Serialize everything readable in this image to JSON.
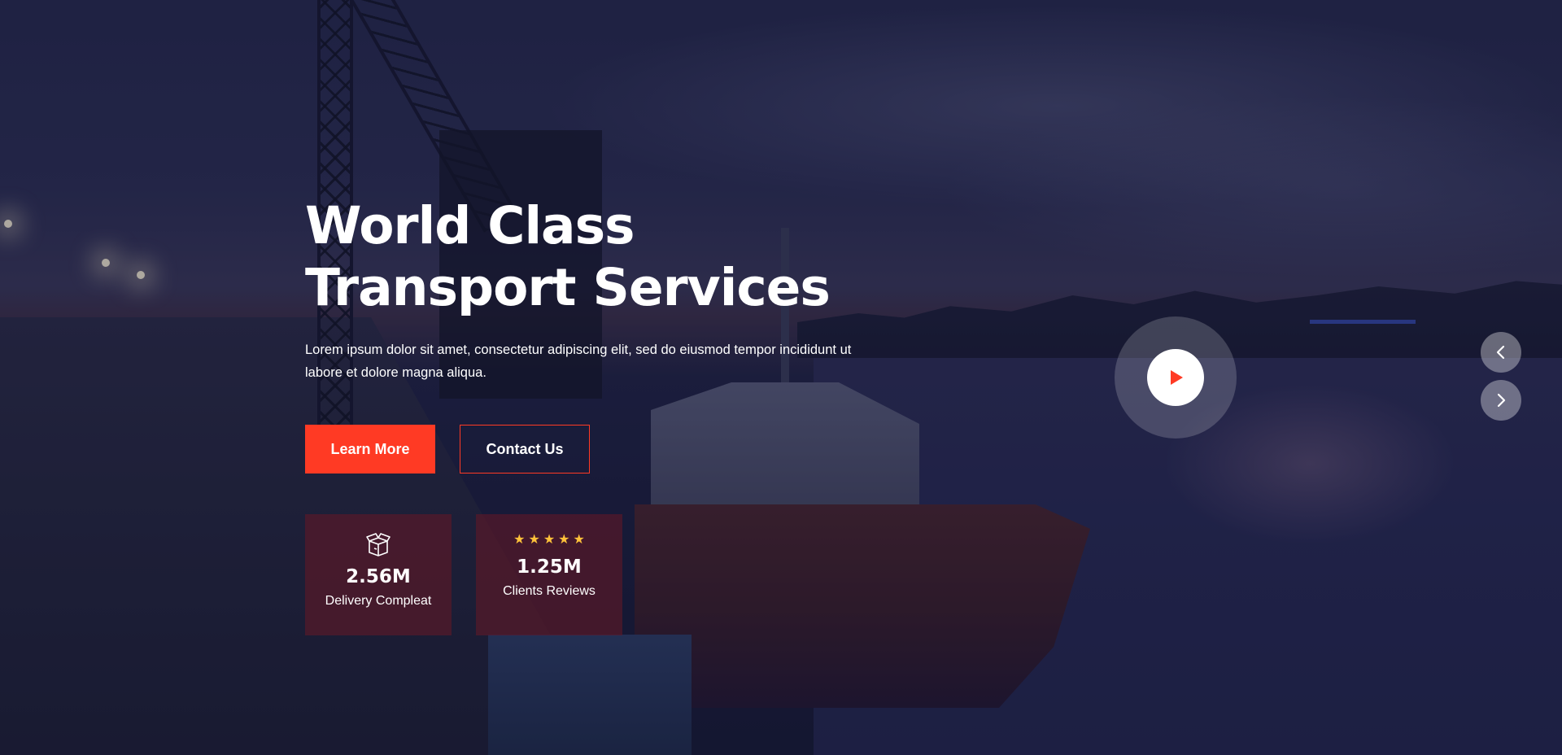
{
  "hero": {
    "title": "World Class Transport Services",
    "subtitle": "Lorem ipsum dolor sit amet, consectetur adipiscing elit, sed do eiusmod tempor incididunt ut labore et dolore magna aliqua.",
    "primary_button": "Learn More",
    "secondary_button": "Contact Us"
  },
  "stats": [
    {
      "icon": "package-icon",
      "value": "2.56M",
      "label": "Delivery Compleat"
    },
    {
      "icon": "stars-rating",
      "rating": 5,
      "value": "1.25M",
      "label": "Clients Reviews"
    }
  ],
  "video": {
    "icon": "play-icon"
  },
  "slider": {
    "prev_icon": "chevron-left-icon",
    "next_icon": "chevron-right-icon"
  },
  "colors": {
    "accent": "#ff3a24",
    "star": "#ffc23a",
    "overlay": "#1b1d3a",
    "card": "#5f1826"
  }
}
